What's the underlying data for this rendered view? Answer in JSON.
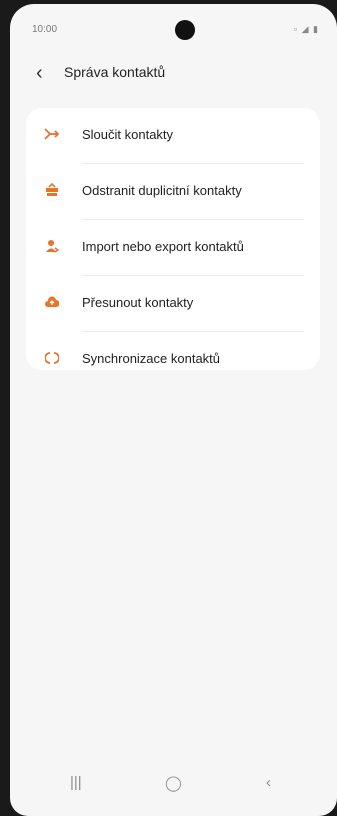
{
  "status_bar": {
    "time": "10:00",
    "icons": "▫ ◢ ▮"
  },
  "header": {
    "back_icon": "‹",
    "title": "Správa kontaktů"
  },
  "menu": {
    "accent_color": "#e8732a",
    "items": [
      {
        "label": "Sloučit kontakty",
        "icon": "merge-icon"
      },
      {
        "label": "Odstranit duplicitní kontakty",
        "icon": "remove-duplicates-icon"
      },
      {
        "label": "Import nebo export kontaktů",
        "icon": "import-export-icon"
      },
      {
        "label": "Přesunout kontakty",
        "icon": "cloud-upload-icon"
      },
      {
        "label": "Synchronizace kontaktů",
        "icon": "sync-icon"
      }
    ]
  },
  "nav_bar": {
    "recents": "|||",
    "home": "◯",
    "back": "‹"
  }
}
